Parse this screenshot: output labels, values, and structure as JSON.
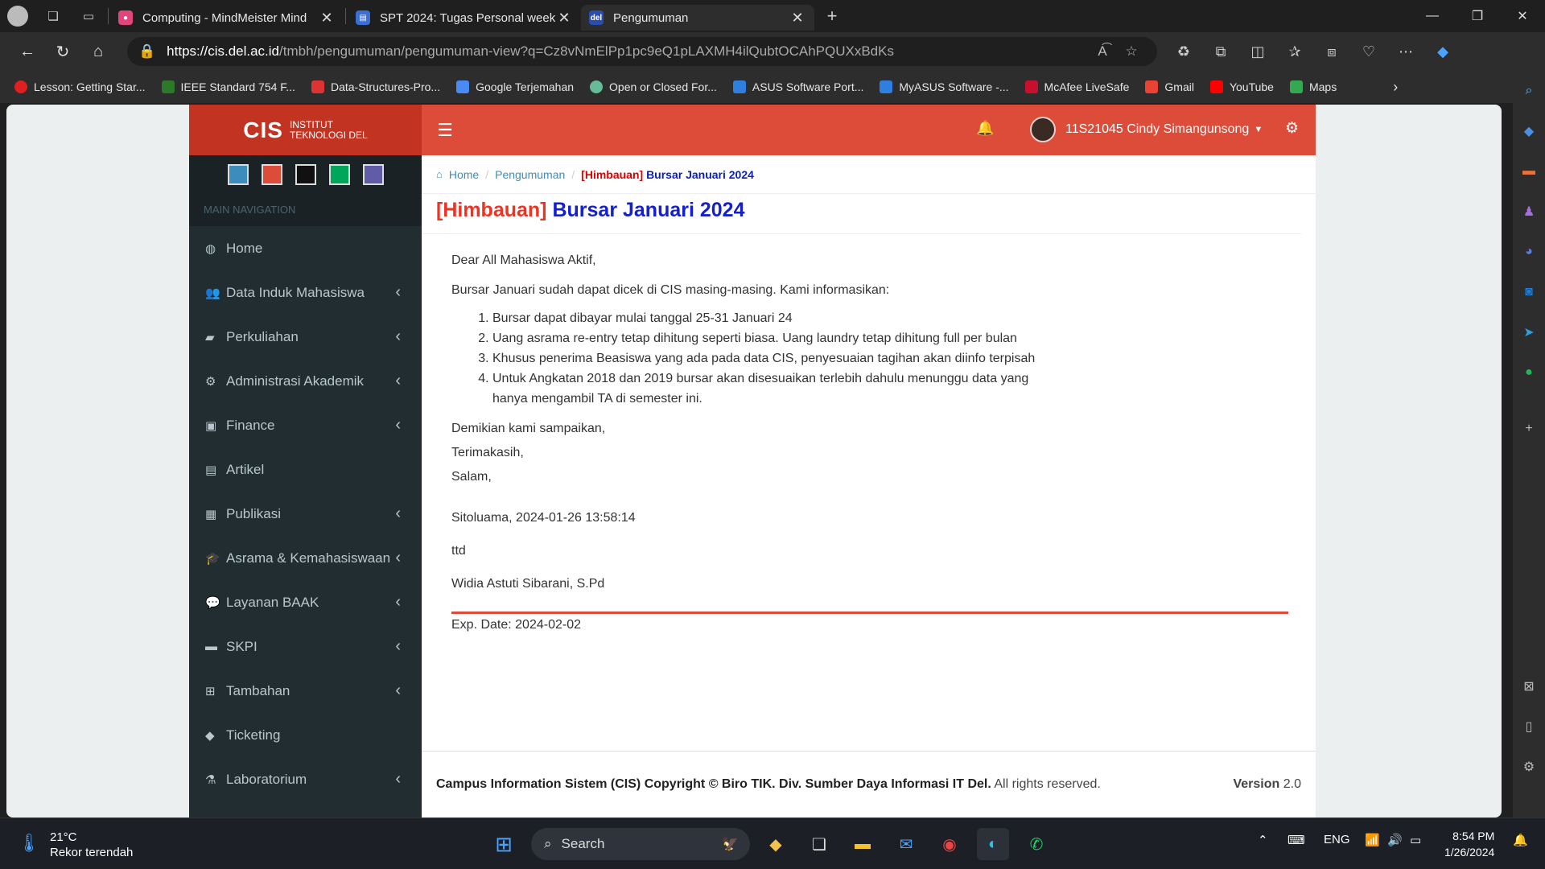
{
  "browser": {
    "tabs": [
      {
        "title": "Computing - MindMeister Mind",
        "icon_color": "#e0457b",
        "active": false
      },
      {
        "title": "SPT 2024: Tugas Personal week#",
        "icon_color": "#3b6fd8",
        "active": false
      },
      {
        "title": "Pengumuman",
        "icon_color": "#2a4db0",
        "active": true
      }
    ],
    "url_host": "https://cis.del.ac.id",
    "url_path": "/tmbh/pengumuman/pengumuman-view?q=Cz8vNmElPp1pc9eQ1pLAXMH4ilQubtOCAhPQUXxBdKs",
    "bookmarks": [
      {
        "label": "Lesson: Getting Star...",
        "color": "#e02020"
      },
      {
        "label": "IEEE Standard 754 F...",
        "color": "#2a7a2a"
      },
      {
        "label": "Data-Structures-Pro...",
        "color": "#d33"
      },
      {
        "label": "Google Terjemahan",
        "color": "#4a8af4"
      },
      {
        "label": "Open or Closed For...",
        "color": "#66bb99"
      },
      {
        "label": "ASUS Software Port...",
        "color": "#2f7fe0"
      },
      {
        "label": "MyASUS Software -...",
        "color": "#2f7fe0"
      },
      {
        "label": "McAfee LiveSafe",
        "color": "#c8102e"
      },
      {
        "label": "Gmail",
        "color": "#ea4335"
      },
      {
        "label": "YouTube",
        "color": "#ff0000"
      },
      {
        "label": "Maps",
        "color": "#34a853"
      }
    ]
  },
  "cis": {
    "logo_main": "CIS",
    "logo_line1": "INSTITUT",
    "logo_line2": "TEKNOLOGI DEL",
    "user_name": "11S21045 Cindy Simangunsong",
    "theme_colors": [
      "#3c8dbc",
      "#dd4b39",
      "#111111",
      "#00a65a",
      "#605ca8"
    ],
    "nav_header": "MAIN NAVIGATION",
    "nav": [
      {
        "label": "Home",
        "icon": "dashboard-icon",
        "glyph": "◍",
        "has_children": false
      },
      {
        "label": "Data Induk Mahasiswa",
        "icon": "users-icon",
        "glyph": "👥",
        "has_children": true
      },
      {
        "label": "Perkuliahan",
        "icon": "book-icon",
        "glyph": "▰",
        "has_children": true
      },
      {
        "label": "Administrasi Akademik",
        "icon": "cogs-icon",
        "glyph": "⚙",
        "has_children": true
      },
      {
        "label": "Finance",
        "icon": "money-icon",
        "glyph": "▣",
        "has_children": true
      },
      {
        "label": "Artikel",
        "icon": "file-icon",
        "glyph": "▤",
        "has_children": false
      },
      {
        "label": "Publikasi",
        "icon": "newspaper-icon",
        "glyph": "▦",
        "has_children": true
      },
      {
        "label": "Asrama & Kemahasiswaan",
        "icon": "graduation-cap-icon",
        "glyph": "🎓",
        "has_children": true
      },
      {
        "label": "Layanan BAAK",
        "icon": "comments-icon",
        "glyph": "💬",
        "has_children": true
      },
      {
        "label": "SKPI",
        "icon": "archive-icon",
        "glyph": "▬",
        "has_children": true
      },
      {
        "label": "Tambahan",
        "icon": "plus-square-icon",
        "glyph": "⊞",
        "has_children": true
      },
      {
        "label": "Ticketing",
        "icon": "tag-icon",
        "glyph": "◆",
        "has_children": false
      },
      {
        "label": "Laboratorium",
        "icon": "flask-icon",
        "glyph": "⚗",
        "has_children": true
      }
    ],
    "breadcrumb": {
      "home": "Home",
      "section": "Pengumuman",
      "current_tag": "[Himbauan]",
      "current_title": "Bursar Januari 2024"
    },
    "announcement": {
      "tag": "[Himbauan]",
      "title": "Bursar Januari 2024",
      "greeting": "Dear All Mahasiswa Aktif,",
      "intro": "Bursar Januari sudah dapat dicek di CIS masing-masing. Kami informasikan:",
      "points": [
        "Bursar dapat dibayar mulai tanggal 25-31 Januari 24",
        "Uang asrama re-entry tetap dihitung seperti biasa. Uang laundry tetap dihitung full per bulan",
        "Khusus penerima Beasiswa yang ada pada data CIS, penyesuaian tagihan akan diinfo terpisah",
        "Untuk Angkatan 2018 dan 2019 bursar akan disesuaikan terlebih dahulu menunggu data yang hanya mengambil TA di semester ini."
      ],
      "closing": "Demikian kami sampaikan,",
      "thanks": "Terimakasih,",
      "salam": "Salam,",
      "place_date": "Sitoluama, 2024-01-26 13:58:14",
      "ttd": "ttd",
      "signer": "Widia Astuti Sibarani, S.Pd",
      "exp_date": "Exp. Date: 2024-02-02"
    },
    "footer": {
      "copyright_bold": "Campus Information Sistem (CIS) Copyright © Biro TIK. Div. Sumber Daya Informasi IT Del.",
      "copyright_rest": "All rights reserved.",
      "version_label": "Version",
      "version_num": "2.0"
    }
  },
  "taskbar": {
    "temp": "21°C",
    "weather_text": "Rekor terendah",
    "search": "Search",
    "lang": "ENG",
    "time": "8:54 PM",
    "date": "1/26/2024"
  }
}
